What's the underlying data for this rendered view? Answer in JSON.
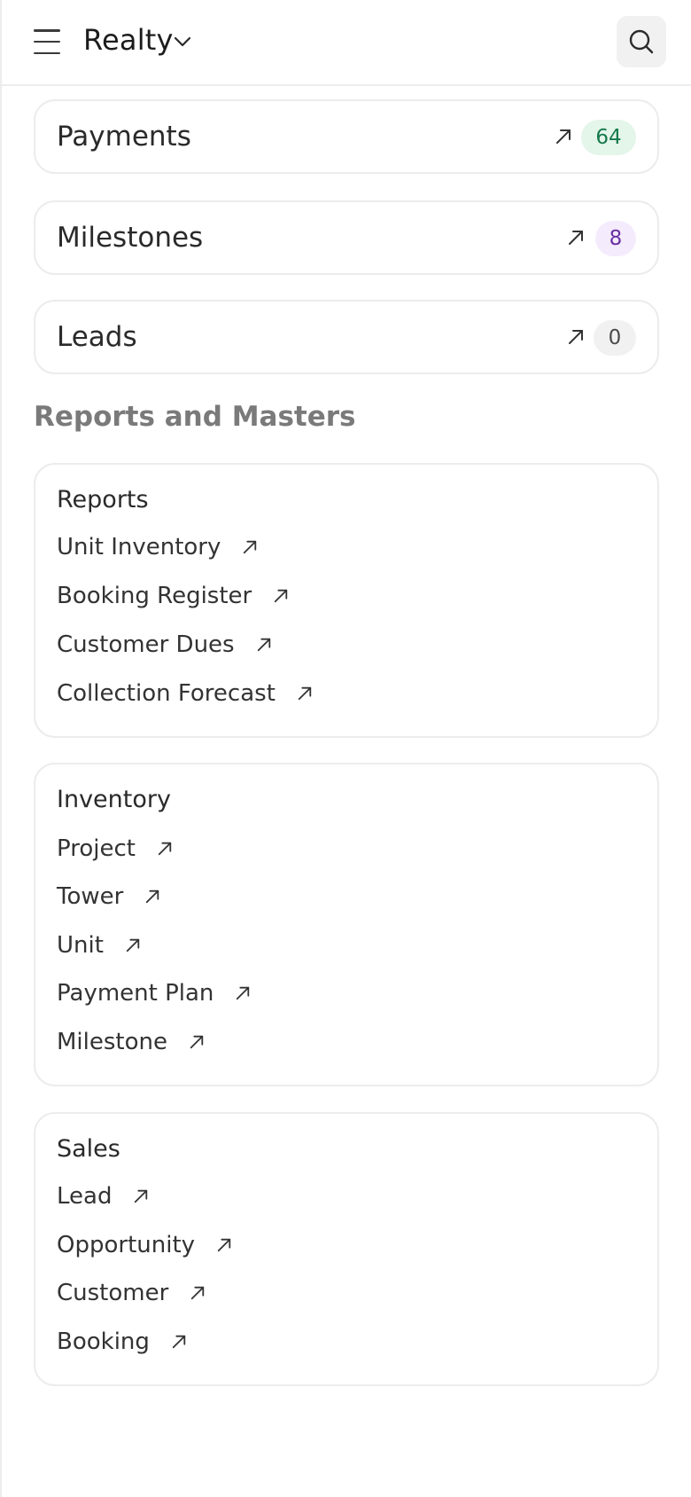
{
  "header": {
    "app_title": "Realty",
    "menu_icon": "hamburger-menu-icon",
    "dropdown_icon": "chevron-down-icon",
    "search_icon": "search-icon"
  },
  "count_cards": [
    {
      "label": "Payments",
      "count": "64",
      "badge_bg": "#e4f5e9",
      "badge_color": "#16794c"
    },
    {
      "label": "Milestones",
      "count": "8",
      "badge_bg": "#f4ecfd",
      "badge_color": "#6b2fa3"
    },
    {
      "label": "Leads",
      "count": "0",
      "badge_bg": "#f1f1f1",
      "badge_color": "#4a4a4a"
    }
  ],
  "section_title": "Reports and Masters",
  "link_cards": [
    {
      "title": "Reports",
      "links": [
        "Unit Inventory",
        "Booking Register",
        "Customer Dues",
        "Collection Forecast"
      ]
    },
    {
      "title": "Inventory",
      "links": [
        "Project",
        "Tower",
        "Unit",
        "Payment Plan",
        "Milestone"
      ]
    },
    {
      "title": "Sales",
      "links": [
        "Lead",
        "Opportunity",
        "Customer",
        "Booking"
      ]
    }
  ],
  "link_icon": "arrow-up-right-icon"
}
